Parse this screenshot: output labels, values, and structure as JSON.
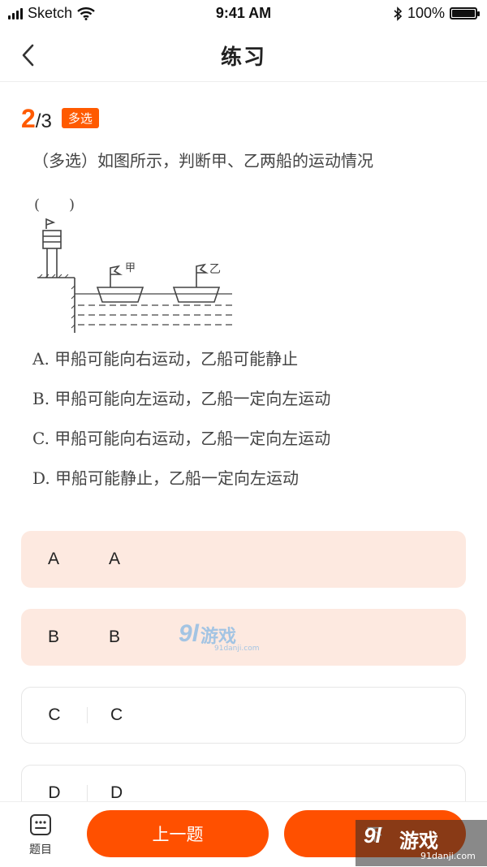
{
  "status_bar": {
    "carrier": "Sketch",
    "time": "9:41 AM",
    "battery": "100%",
    "battery_level": 1.0
  },
  "nav": {
    "title": "练习"
  },
  "question": {
    "current": "2",
    "total": "/3",
    "type_tag": "多选",
    "stem": "（多选）如图所示，判断甲、乙两船的运动情况",
    "paren": "(　　)",
    "figure_labels": {
      "boat1": "甲",
      "boat2": "乙"
    },
    "options": [
      "A.  甲船可能向右运动，乙船可能静止",
      "B.  甲船可能向左运动，乙船一定向左运动",
      "C.  甲船可能向右运动，乙船一定向左运动",
      "D.  甲船可能静止，乙船一定向左运动"
    ]
  },
  "answers": [
    {
      "letter": "A",
      "text": "A",
      "selected": true
    },
    {
      "letter": "B",
      "text": "B",
      "selected": true
    },
    {
      "letter": "C",
      "text": "C",
      "selected": false
    },
    {
      "letter": "D",
      "text": "D",
      "selected": false
    }
  ],
  "bottom_bar": {
    "tab_label": "题目",
    "prev_label": "上一题",
    "next_label": "下"
  },
  "watermark": {
    "logo": "9l",
    "brand": "游戏",
    "url_small": "91danji.com",
    "url_corner": "91danji.com"
  },
  "colors": {
    "accent": "#ff5a00",
    "selected_bg": "#fde9e0"
  }
}
